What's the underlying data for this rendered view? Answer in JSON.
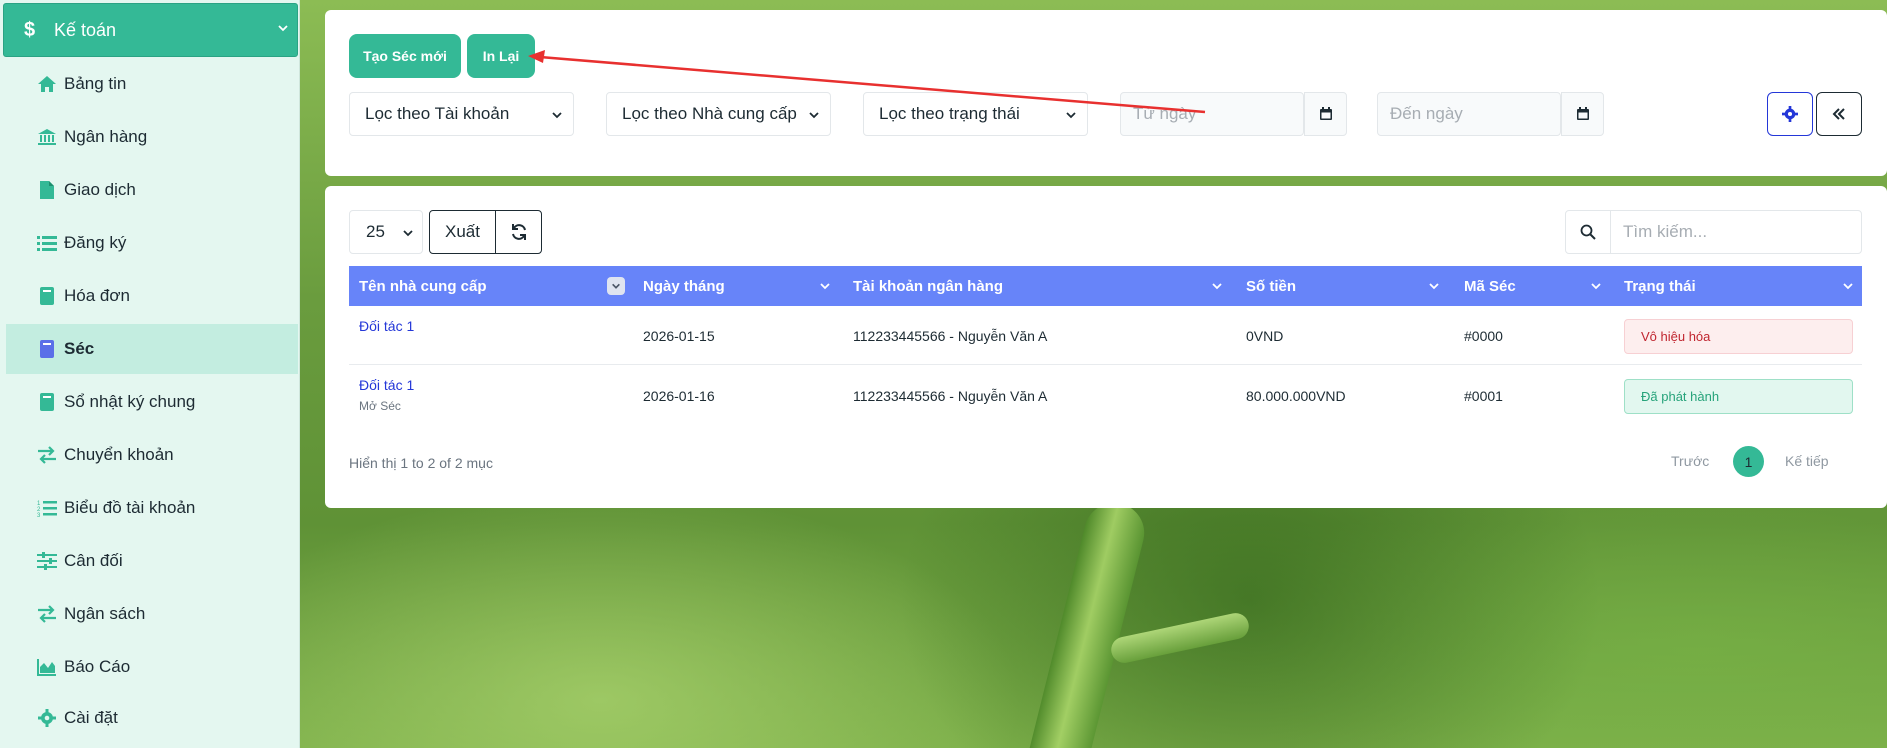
{
  "sidebar": {
    "header": {
      "label": "Kế toán",
      "icon": "dollar-icon"
    },
    "items": [
      {
        "label": "Bảng tin",
        "icon": "home-icon"
      },
      {
        "label": "Ngân hàng",
        "icon": "bank-icon"
      },
      {
        "label": "Giao dịch",
        "icon": "file-icon"
      },
      {
        "label": "Đăng ký",
        "icon": "list-icon"
      },
      {
        "label": "Hóa đơn",
        "icon": "book-icon"
      },
      {
        "label": "Séc",
        "icon": "book-icon",
        "active": true
      },
      {
        "label": "Sổ nhật ký chung",
        "icon": "book-icon"
      },
      {
        "label": "Chuyển khoản",
        "icon": "exchange-icon"
      },
      {
        "label": "Biểu đồ tài khoản",
        "icon": "ordered-list-icon"
      },
      {
        "label": "Cân đối",
        "icon": "sliders-icon"
      },
      {
        "label": "Ngân sách",
        "icon": "exchange-icon"
      },
      {
        "label": "Báo Cáo",
        "icon": "area-chart-icon"
      },
      {
        "label": "Cài đặt",
        "icon": "gear-icon"
      }
    ]
  },
  "toolbar": {
    "new_check_label": "Tạo Séc mới",
    "reprint_label": "In Lại",
    "filter_account": "Lọc theo Tài khoản",
    "filter_supplier": "Lọc theo Nhà cung cấp",
    "filter_status": "Lọc theo trạng thái",
    "from_date_placeholder": "Từ ngày",
    "to_date_placeholder": "Đến ngày"
  },
  "table_controls": {
    "page_size": "25",
    "export_label": "Xuất",
    "search_placeholder": "Tìm kiếm..."
  },
  "table": {
    "columns": [
      "Tên nhà cung cấp",
      "Ngày tháng",
      "Tài khoản ngân hàng",
      "Số tiền",
      "Mã Séc",
      "Trạng thái"
    ],
    "rows": [
      {
        "supplier": "Đối tác 1",
        "sub": "",
        "date": "2026-01-15",
        "account": "112233445566 - Nguyễn Văn A",
        "amount": "0VND",
        "code": "#0000",
        "status": "Vô hiệu hóa"
      },
      {
        "supplier": "Đối tác 1",
        "sub": "Mở Séc",
        "date": "2026-01-16",
        "account": "112233445566 - Nguyễn Văn A",
        "amount": "80.000.000VND",
        "code": "#0001",
        "status": "Đã phát hành"
      }
    ]
  },
  "footer": {
    "info": "Hiển thị 1 to 2 of 2 mục",
    "prev": "Trước",
    "current_page": "1",
    "next": "Kế tiếp"
  },
  "colors": {
    "accent": "#34b996",
    "table_header": "#6784f9",
    "annotation_arrow": "#e8302f"
  }
}
